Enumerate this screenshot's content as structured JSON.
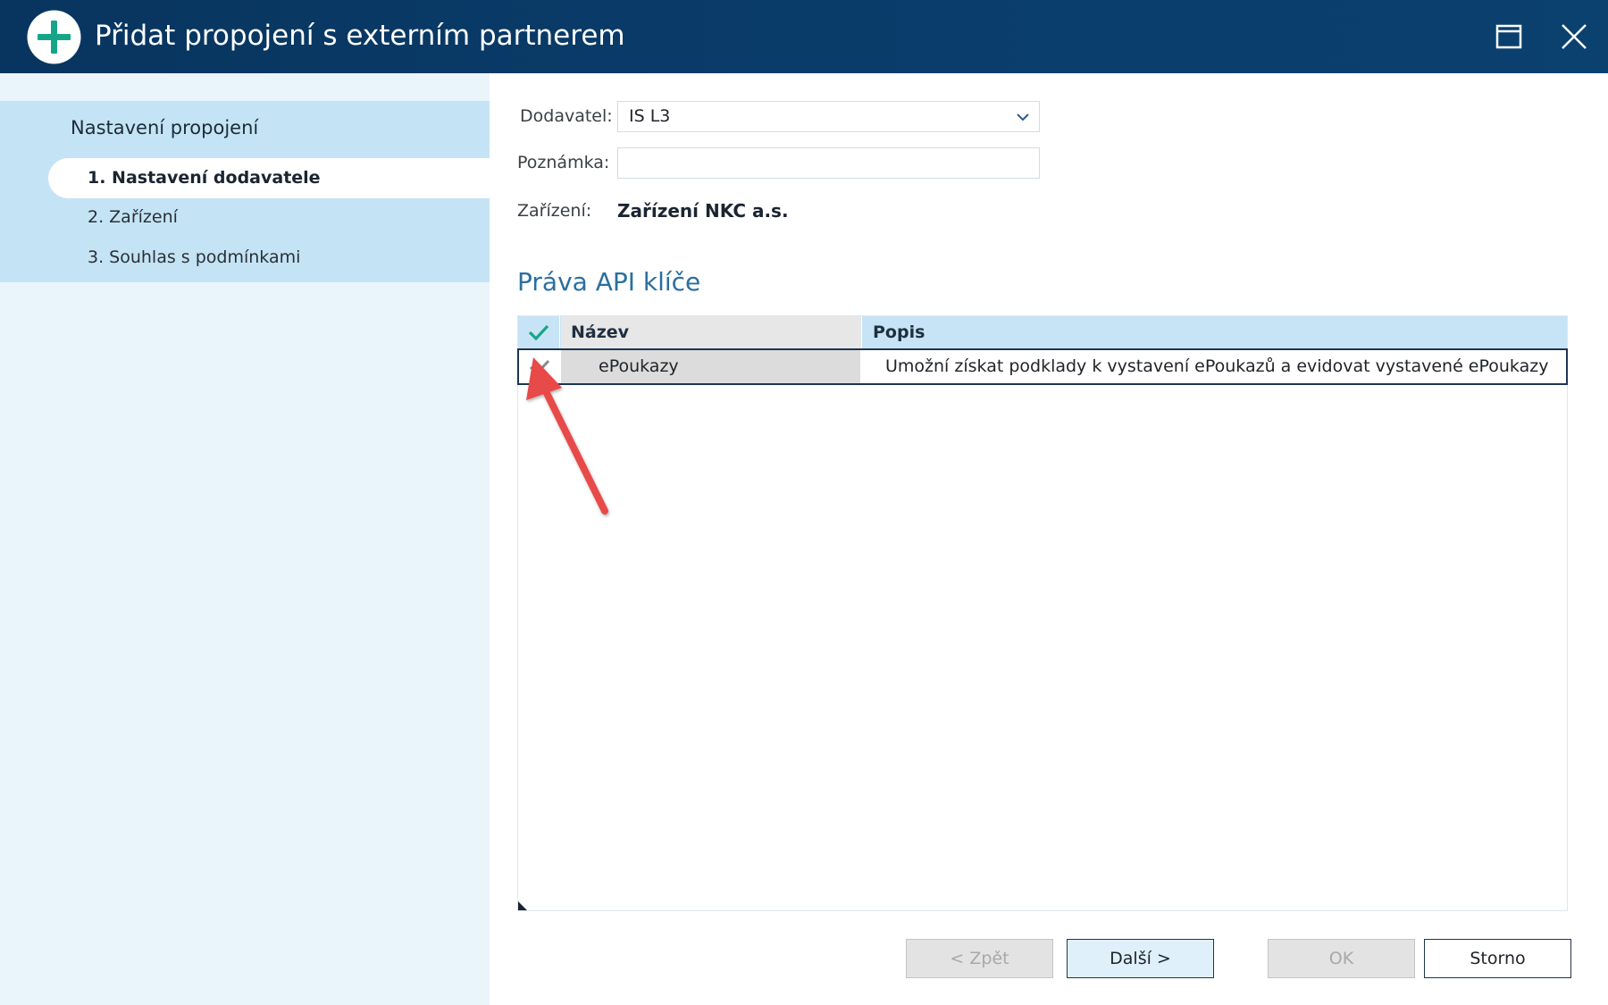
{
  "window": {
    "title": "Přidat propojení s externím partnerem",
    "icons": [
      "add-circle-icon",
      "maximize-icon",
      "close-icon"
    ]
  },
  "sidebar": {
    "heading": "Nastavení propojení",
    "steps": [
      {
        "label": "1. Nastavení dodavatele",
        "active": true
      },
      {
        "label": "2. Zařízení",
        "active": false
      },
      {
        "label": "3. Souhlas s podmínkami",
        "active": false
      }
    ]
  },
  "form": {
    "supplier_label": "Dodavatel:",
    "supplier_value": "IS L3",
    "note_label": "Poznámka:",
    "note_value": "",
    "device_label": "Zařízení:",
    "device_value": "Zařízení NKC a.s."
  },
  "api_rights": {
    "title": "Práva API klíče",
    "columns": {
      "name": "Název",
      "description": "Popis"
    },
    "rows": [
      {
        "checked": true,
        "name": "ePoukazy",
        "description": "Umožní získat podklady k vystavení ePoukazů a evidovat vystavené ePoukazy"
      }
    ]
  },
  "buttons": {
    "back": "< Zpět",
    "next": "Další >",
    "ok": "OK",
    "cancel": "Storno"
  },
  "colors": {
    "titlebar": "#0a3c6a",
    "accent_green": "#17a589",
    "sidebar_bg": "#e9f4fb",
    "steps_bg": "#c4e4f5",
    "header_bg": "#c7e4f6",
    "section_title": "#2a6f9f",
    "annotation_arrow": "#e84a4a"
  }
}
